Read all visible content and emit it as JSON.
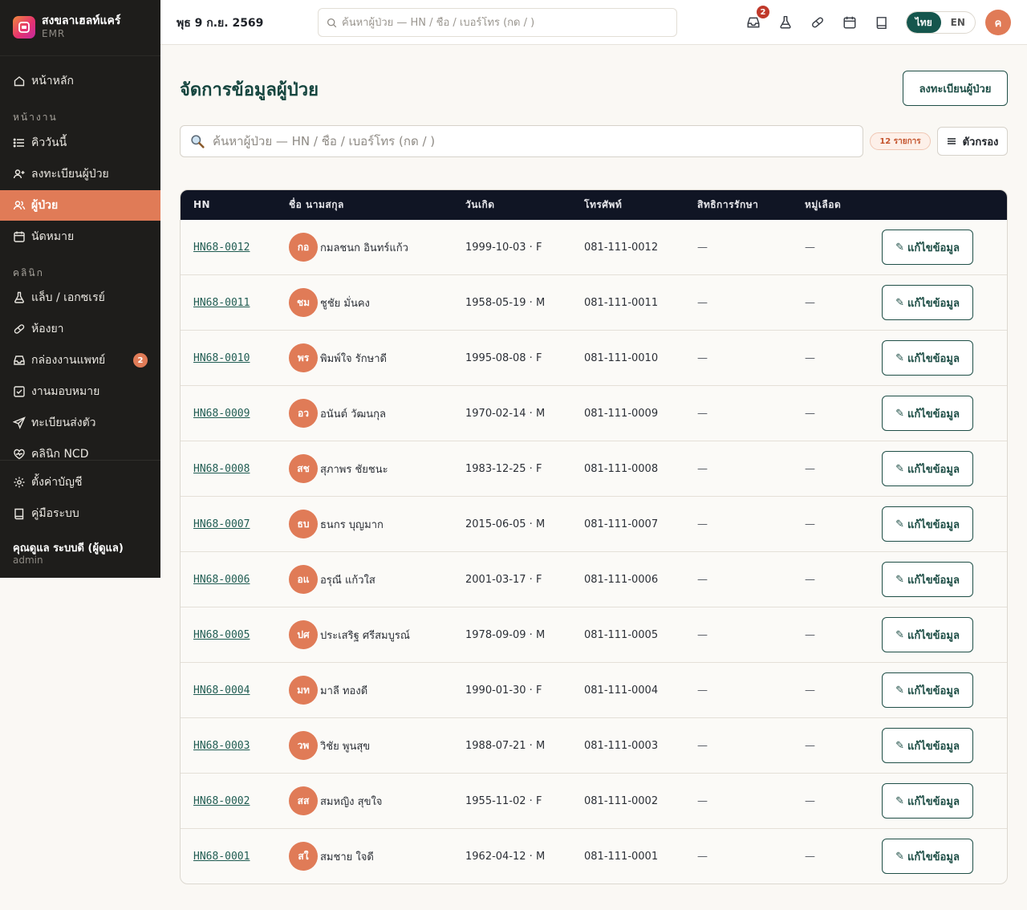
{
  "brand": {
    "name": "สงขลาเฮลท์แคร์",
    "sub": "EMR"
  },
  "sidebar": {
    "home": "หน้าหลัก",
    "section_work": "หน้างาน",
    "section_clinic": "คลินิก",
    "items_work": [
      {
        "label": "คิววันนี้",
        "icon": "list-icon"
      },
      {
        "label": "ลงทะเบียนผู้ป่วย",
        "icon": "user-plus-icon"
      },
      {
        "label": "ผู้ป่วย",
        "icon": "users-icon",
        "active": true
      },
      {
        "label": "นัดหมาย",
        "icon": "calendar-icon"
      }
    ],
    "items_clinic": [
      {
        "label": "แล็บ / เอกซเรย์",
        "icon": "flask-icon"
      },
      {
        "label": "ห้องยา",
        "icon": "pill-icon"
      },
      {
        "label": "กล่องงานแพทย์",
        "icon": "inbox-icon",
        "badge": "2"
      },
      {
        "label": "งานมอบหมาย",
        "icon": "checkbox-icon"
      },
      {
        "label": "ทะเบียนส่งตัว",
        "icon": "send-icon"
      },
      {
        "label": "คลินิก NCD",
        "icon": "heart-icon"
      }
    ],
    "settings": "ตั้งค่าบัญชี",
    "manual": "คู่มือระบบ",
    "user_name": "คุณดูแล ระบบดี (ผู้ดูแล)",
    "user_role": "admin"
  },
  "topbar": {
    "date": "พุธ 9 ก.ย. 2569",
    "search_placeholder": "ค้นหาผู้ป่วย — HN / ชื่อ / เบอร์โทร (กด / )",
    "inbox_badge": "2",
    "lang_th": "ไทย",
    "lang_en": "EN",
    "avatar": "ค"
  },
  "main": {
    "title": "จัดการข้อมูลผู้ป่วย",
    "register_label": "ลงทะเบียนผู้ป่วย",
    "search_placeholder": "ค้นหาผู้ป่วย — HN / ชื่อ / เบอร์โทร (กด / )",
    "count": "12 รายการ",
    "filter_label": "ตัวกรอง"
  },
  "table": {
    "columns": [
      "HN",
      "ชื่อ นามสกุล",
      "วันเกิด",
      "โทรศัพท์",
      "สิทธิการรักษา",
      "หมู่เลือด"
    ],
    "edit_label": "แก้ไขข้อมูล",
    "rows": [
      {
        "hn": "HN68-0012",
        "initials": "กอ",
        "name": "กมลชนก อินทร์แก้ว",
        "dob": "1999-10-03 · F",
        "phone": "081-111-0012",
        "right": "—",
        "blood": "—"
      },
      {
        "hn": "HN68-0011",
        "initials": "ชม",
        "name": "ชูชัย มั่นคง",
        "dob": "1958-05-19 · M",
        "phone": "081-111-0011",
        "right": "—",
        "blood": "—"
      },
      {
        "hn": "HN68-0010",
        "initials": "พร",
        "name": "พิมพ์ใจ รักษาดี",
        "dob": "1995-08-08 · F",
        "phone": "081-111-0010",
        "right": "—",
        "blood": "—"
      },
      {
        "hn": "HN68-0009",
        "initials": "อว",
        "name": "อนันต์ วัฒนกุล",
        "dob": "1970-02-14 · M",
        "phone": "081-111-0009",
        "right": "—",
        "blood": "—"
      },
      {
        "hn": "HN68-0008",
        "initials": "สช",
        "name": "สุภาพร ชัยชนะ",
        "dob": "1983-12-25 · F",
        "phone": "081-111-0008",
        "right": "—",
        "blood": "—"
      },
      {
        "hn": "HN68-0007",
        "initials": "ธบ",
        "name": "ธนกร บุญมาก",
        "dob": "2015-06-05 · M",
        "phone": "081-111-0007",
        "right": "—",
        "blood": "—"
      },
      {
        "hn": "HN68-0006",
        "initials": "อแ",
        "name": "อรุณี แก้วใส",
        "dob": "2001-03-17 · F",
        "phone": "081-111-0006",
        "right": "—",
        "blood": "—"
      },
      {
        "hn": "HN68-0005",
        "initials": "ปศ",
        "name": "ประเสริฐ ศรีสมบูรณ์",
        "dob": "1978-09-09 · M",
        "phone": "081-111-0005",
        "right": "—",
        "blood": "—"
      },
      {
        "hn": "HN68-0004",
        "initials": "มท",
        "name": "มาลี ทองดี",
        "dob": "1990-01-30 · F",
        "phone": "081-111-0004",
        "right": "—",
        "blood": "—"
      },
      {
        "hn": "HN68-0003",
        "initials": "วพ",
        "name": "วิชัย พูนสุข",
        "dob": "1988-07-21 · M",
        "phone": "081-111-0003",
        "right": "—",
        "blood": "—"
      },
      {
        "hn": "HN68-0002",
        "initials": "สส",
        "name": "สมหญิง สุขใจ",
        "dob": "1955-11-02 · F",
        "phone": "081-111-0002",
        "right": "—",
        "blood": "—"
      },
      {
        "hn": "HN68-0001",
        "initials": "สใ",
        "name": "สมชาย ใจดี",
        "dob": "1962-04-12 · M",
        "phone": "081-111-0001",
        "right": "—",
        "blood": "—"
      }
    ]
  },
  "colors": {
    "accent": "#e07b57",
    "brand_green": "#15564d",
    "sidebar_bg": "#1e1d1b",
    "table_header": "#101524"
  }
}
